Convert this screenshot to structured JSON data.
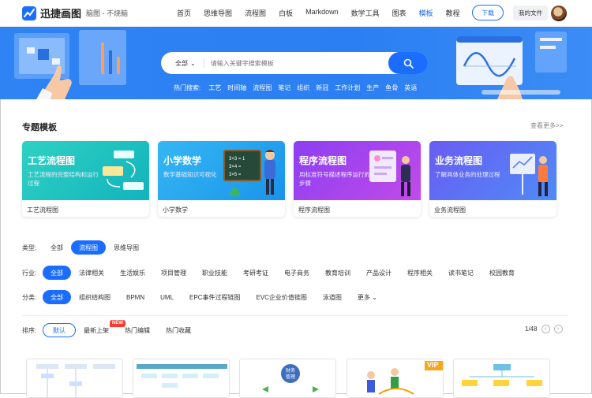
{
  "header": {
    "brand": "迅捷画图",
    "slogan": "脑图 - 不烧脑",
    "menu": [
      "首页",
      "思维导图",
      "流程图",
      "白板",
      "Markdown",
      "数学工具",
      "图表",
      "模板",
      "教程"
    ],
    "active_menu": "模板",
    "download_label": "下载",
    "my_files_label": "我的文件"
  },
  "search": {
    "category": "全部",
    "placeholder": "请输入关键字搜索模板",
    "hot_title": "热门搜索:",
    "hot_tags": [
      "工艺",
      "时间轴",
      "流程图",
      "笔记",
      "组织",
      "新冠",
      "工作计划",
      "生产",
      "鱼骨",
      "英语"
    ]
  },
  "topics": {
    "title": "专题模板",
    "more": "查看更多>>",
    "cards": [
      {
        "title": "工艺流程图",
        "desc": "工艺流程的完整结构和运行过程",
        "caption": "工艺流程图",
        "color_a": "#2fd1c3",
        "color_b": "#12b3bd"
      },
      {
        "title": "小学数学",
        "desc": "数学基础知识可视化",
        "caption": "小学数学",
        "color_a": "#35b7f3",
        "color_b": "#1a93ea"
      },
      {
        "title": "程序流程图",
        "desc": "用标准符号描述程序运行的步骤",
        "caption": "程序流程图",
        "color_a": "#8b3ff2",
        "color_b": "#c24be8"
      },
      {
        "title": "业务流程图",
        "desc": "了解具体业务的处理过程",
        "caption": "业务流程图",
        "color_a": "#6a5cf2",
        "color_b": "#4f8bf7"
      }
    ]
  },
  "filters": {
    "type": {
      "label": "类型:",
      "options": [
        "全部",
        "流程图",
        "思维导图"
      ],
      "selected": "流程图"
    },
    "industry": {
      "label": "行业:",
      "options": [
        "全部",
        "法律相关",
        "生活娱乐",
        "项目管理",
        "职业技能",
        "考研考证",
        "电子商务",
        "教育培训",
        "产品设计",
        "程序相关",
        "读书笔记",
        "校园教育"
      ],
      "selected": "全部"
    },
    "category": {
      "label": "分类:",
      "options": [
        "全部",
        "组织结构图",
        "BPMN",
        "UML",
        "EPC事件过程链图",
        "EVC企业价值链图",
        "泳道图",
        "更多"
      ],
      "selected": "全部"
    },
    "sort": {
      "label": "排序:",
      "options": [
        "默认",
        "最新上架",
        "热门编辑",
        "热门收藏"
      ],
      "selected": "默认",
      "new_badge": "NEW"
    },
    "pager": "1/48"
  },
  "thumbs": {
    "vip_label": "VIP",
    "finance_label_1": "财务",
    "finance_label_2": "管理"
  },
  "colors": {
    "accent": "#1a6dff",
    "banner": "#2f83f3"
  }
}
